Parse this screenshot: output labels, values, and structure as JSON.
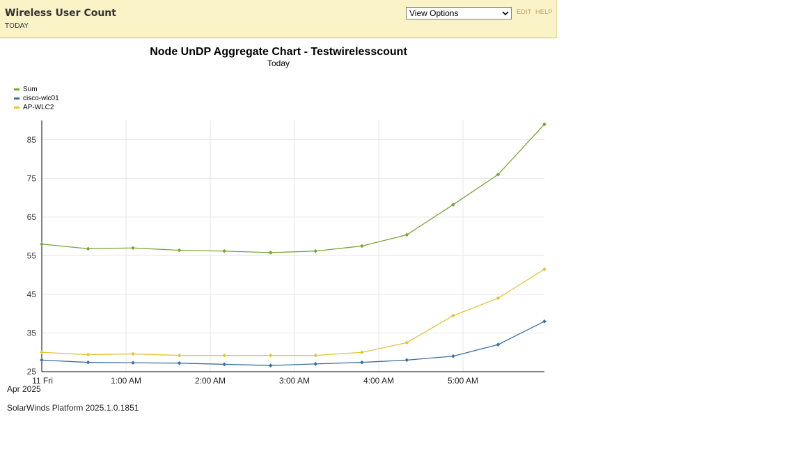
{
  "header": {
    "title": "Wireless User Count",
    "subtitle": "TODAY",
    "view_options": "View Options",
    "edit_label": "EDIT",
    "help_label": "HELP"
  },
  "footer": {
    "platform": "SolarWinds Platform 2025.1.0.1851"
  },
  "colors": {
    "sum": "#77a534",
    "cisco": "#3a6f9f",
    "apwlc": "#e2c53a",
    "header_bg": "#fbf3c8"
  },
  "chart_data": {
    "type": "line",
    "title": "Node UnDP Aggregate Chart - Testwirelesscount",
    "subtitle": "Today",
    "xlabel": "",
    "ylabel": "",
    "ylim": [
      25,
      90
    ],
    "yticks": [
      25,
      35,
      45,
      55,
      65,
      75,
      85
    ],
    "x_tick_labels": [
      "11 Fri",
      "1:00 AM",
      "2:00 AM",
      "3:00 AM",
      "4:00 AM",
      "5:00 AM"
    ],
    "x_sub_label": "Apr 2025",
    "x": [
      "00:00",
      "00:33",
      "01:05",
      "01:38",
      "02:10",
      "02:43",
      "03:15",
      "03:48",
      "04:20",
      "04:53",
      "05:25",
      "05:58"
    ],
    "grid": true,
    "legend_position": "top-left",
    "series": [
      {
        "name": "Sum",
        "color": "#77a534",
        "values": [
          58,
          56.8,
          57,
          56.4,
          56.2,
          55.8,
          56.2,
          57.5,
          60.4,
          68.2,
          76,
          89
        ]
      },
      {
        "name": "cisco-wlc01",
        "color": "#3a6f9f",
        "values": [
          28,
          27.4,
          27.3,
          27.2,
          26.9,
          26.6,
          27,
          27.4,
          28,
          29,
          32,
          38
        ]
      },
      {
        "name": "AP-WLC2",
        "color": "#e2c53a",
        "values": [
          30,
          29.4,
          29.6,
          29.2,
          29.2,
          29.2,
          29.2,
          30,
          32.5,
          39.5,
          44,
          51.5
        ]
      }
    ]
  }
}
